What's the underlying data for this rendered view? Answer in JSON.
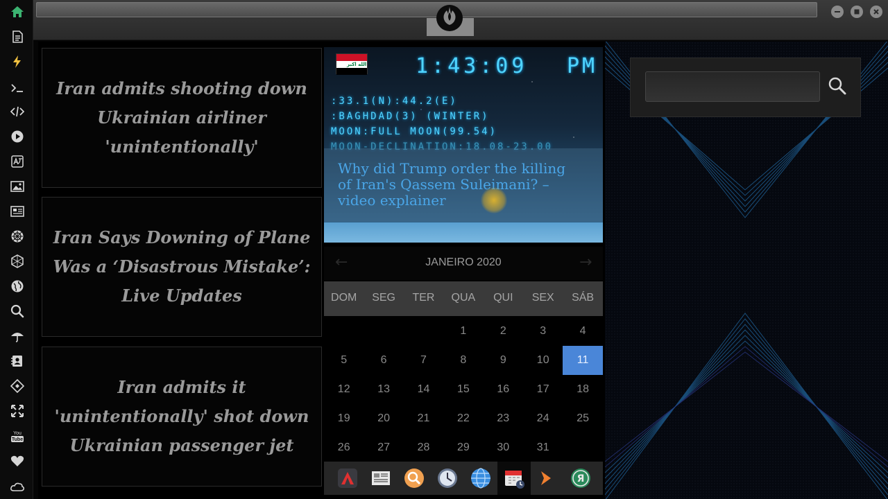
{
  "window": {
    "controls": [
      "minimize",
      "maximize",
      "close"
    ],
    "logo_icon": "rebel-alliance-icon"
  },
  "sidebar": {
    "items": [
      {
        "icon": "home-icon",
        "color": "#3cb371"
      },
      {
        "icon": "document-icon"
      },
      {
        "icon": "lightning-icon",
        "color": "#f0c040"
      },
      {
        "icon": "terminal-icon"
      },
      {
        "icon": "code-icon"
      },
      {
        "icon": "play-icon"
      },
      {
        "icon": "translate-icon"
      },
      {
        "icon": "image-icon"
      },
      {
        "icon": "newspaper-icon"
      },
      {
        "icon": "sci-icon"
      },
      {
        "icon": "hexagon-icon"
      },
      {
        "icon": "globe-icon"
      },
      {
        "icon": "search-icon"
      },
      {
        "icon": "umbrella-icon"
      },
      {
        "icon": "contacts-icon"
      },
      {
        "icon": "tag-icon"
      },
      {
        "icon": "expand-icon"
      },
      {
        "icon": "youtube-icon"
      },
      {
        "icon": "heart-icon"
      },
      {
        "icon": "cloud-icon"
      }
    ]
  },
  "news_cards": [
    {
      "headline": "Iran admits shooting down Ukrainian airliner 'unintentionally'"
    },
    {
      "headline": "Iran Says Downing of Plane Was a ‘Disastrous Mistake’: Live Updates"
    },
    {
      "headline": "Iran admits it 'unintentionally' shot down Ukrainian passenger jet"
    }
  ],
  "clock_widget": {
    "flag": {
      "country": "Iraq",
      "icon": "iraq-flag-icon",
      "script": "الله اكبر"
    },
    "time": "1:43:09",
    "ampm": "PM",
    "coords": ":33.1(N):44.2(E)",
    "location": ":BAGHDAD(3) (WINTER)",
    "moon": "MOON:FULL MOON(99.54)",
    "moon_declination": "MOON-DECLINATION:18.08-23.00",
    "news_headline": "Why did Trump order the killing of Iran's Qassem Suleimani? – video explainer",
    "accent_color": "#4fd4ff"
  },
  "calendar": {
    "title": "JANEIRO 2020",
    "prev_icon": "arrow-left-icon",
    "next_icon": "arrow-right-icon",
    "weekdays": [
      "DOM",
      "SEG",
      "TER",
      "QUA",
      "QUI",
      "SEX",
      "SÁB"
    ],
    "weeks": [
      [
        "",
        "",
        "",
        "1",
        "2",
        "3",
        "4"
      ],
      [
        "5",
        "6",
        "7",
        "8",
        "9",
        "10",
        "11"
      ],
      [
        "12",
        "13",
        "14",
        "15",
        "16",
        "17",
        "18"
      ],
      [
        "19",
        "20",
        "21",
        "22",
        "23",
        "24",
        "25"
      ],
      [
        "26",
        "27",
        "28",
        "29",
        "30",
        "31",
        ""
      ]
    ],
    "today": "11",
    "today_color": "#4a86d8"
  },
  "dock": {
    "items": [
      {
        "icon": "arch-app-icon"
      },
      {
        "icon": "news-reader-icon"
      },
      {
        "icon": "magnifier-app-icon"
      },
      {
        "icon": "clock-app-icon"
      },
      {
        "icon": "globe-app-icon"
      },
      {
        "icon": "calendar-app-icon",
        "active": true
      },
      {
        "icon": "arrow-app-icon"
      },
      {
        "icon": "yandex-icon",
        "letter": "Я"
      }
    ]
  },
  "search": {
    "value": "",
    "placeholder": "",
    "button_icon": "search-icon"
  }
}
